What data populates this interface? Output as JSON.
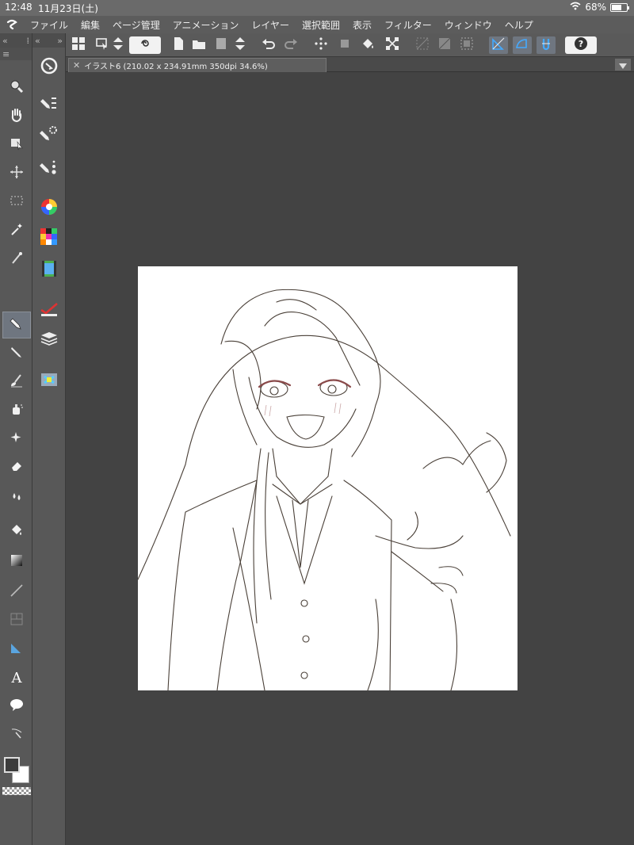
{
  "status": {
    "time": "12:48",
    "date": "11月23日(土)",
    "battery": "68%",
    "battery_level": 0.68
  },
  "menu": {
    "items": [
      "ファイル",
      "編集",
      "ページ管理",
      "アニメーション",
      "レイヤー",
      "選択範囲",
      "表示",
      "フィルター",
      "ウィンドウ",
      "ヘルプ"
    ]
  },
  "tab": {
    "title": "イラスト6 (210.02 x 234.91mm 350dpi 34.6%)"
  },
  "tools": [
    {
      "name": "zoom-tool",
      "icon": "magnifier-icon"
    },
    {
      "name": "hand-tool",
      "icon": "hand-icon"
    },
    {
      "name": "operation-tool",
      "icon": "operation-icon"
    },
    {
      "name": "move-layer-tool",
      "icon": "move-layer-icon"
    },
    {
      "name": "selection-tool",
      "icon": "selection-rect-icon"
    },
    {
      "name": "auto-select-tool",
      "icon": "magic-wand-icon"
    },
    {
      "name": "eyedropper-tool",
      "icon": "eyedropper-icon"
    },
    {
      "name": "pen-tool",
      "icon": "pen-icon",
      "active": true
    },
    {
      "name": "pencil-tool",
      "icon": "pencil-icon"
    },
    {
      "name": "brush-tool",
      "icon": "brush-icon"
    },
    {
      "name": "airbrush-tool",
      "icon": "airbrush-icon"
    },
    {
      "name": "decoration-tool",
      "icon": "sparkle-icon"
    },
    {
      "name": "eraser-tool",
      "icon": "eraser-icon"
    },
    {
      "name": "blend-tool",
      "icon": "blend-drops-icon"
    },
    {
      "name": "fill-tool",
      "icon": "paint-bucket-icon"
    },
    {
      "name": "gradient-tool",
      "icon": "gradient-icon"
    },
    {
      "name": "figure-tool",
      "icon": "line-icon"
    },
    {
      "name": "frame-border-tool",
      "icon": "frame-icon"
    },
    {
      "name": "ruler-tool",
      "icon": "ruler-icon"
    },
    {
      "name": "text-tool",
      "icon": "text-icon"
    },
    {
      "name": "balloon-tool",
      "icon": "speech-balloon-icon"
    },
    {
      "name": "correct-line-tool",
      "icon": "correct-line-icon"
    }
  ],
  "text_tool_glyph": "A",
  "colors": {
    "main": "#3c3c3c",
    "sub": "#ffffff",
    "accent": "#6f7680",
    "lineart": "#4a4038",
    "eyeshadow": "#8a4a4a"
  }
}
